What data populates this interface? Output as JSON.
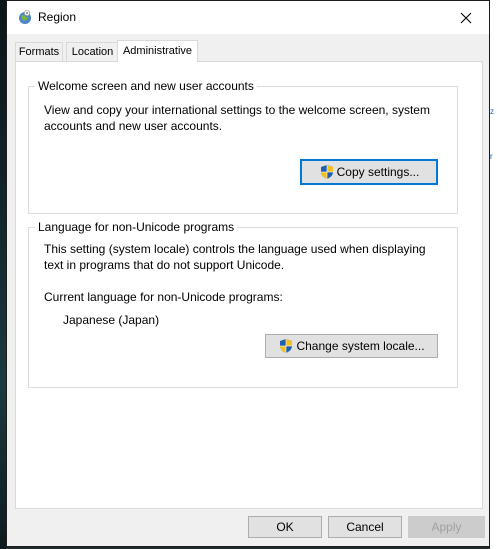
{
  "window": {
    "title": "Region"
  },
  "tabs": [
    {
      "label": "Formats"
    },
    {
      "label": "Location"
    },
    {
      "label": "Administrative",
      "active": true
    }
  ],
  "welcome_group": {
    "title": "Welcome screen and new user accounts",
    "description_line1": "View and copy your international settings to the welcome screen, system",
    "description_line2": "accounts and new user accounts.",
    "button_label": "Copy settings..."
  },
  "locale_group": {
    "title": "Language for non-Unicode programs",
    "description_line1": "This setting (system locale) controls the language used when displaying",
    "description_line2": "text in programs that do not support Unicode.",
    "current_label": "Current language for non-Unicode programs:",
    "current_value": "Japanese (Japan)",
    "button_label": "Change system locale..."
  },
  "footer": {
    "ok_label": "OK",
    "cancel_label": "Cancel",
    "apply_label": "Apply"
  },
  "icons": {
    "app": "globe-icon",
    "close": "close-icon",
    "shield": "uac-shield-icon"
  },
  "colors": {
    "focus_border": "#0078d7",
    "window_bg": "#f0f0f0",
    "panel_bg": "#ffffff"
  }
}
